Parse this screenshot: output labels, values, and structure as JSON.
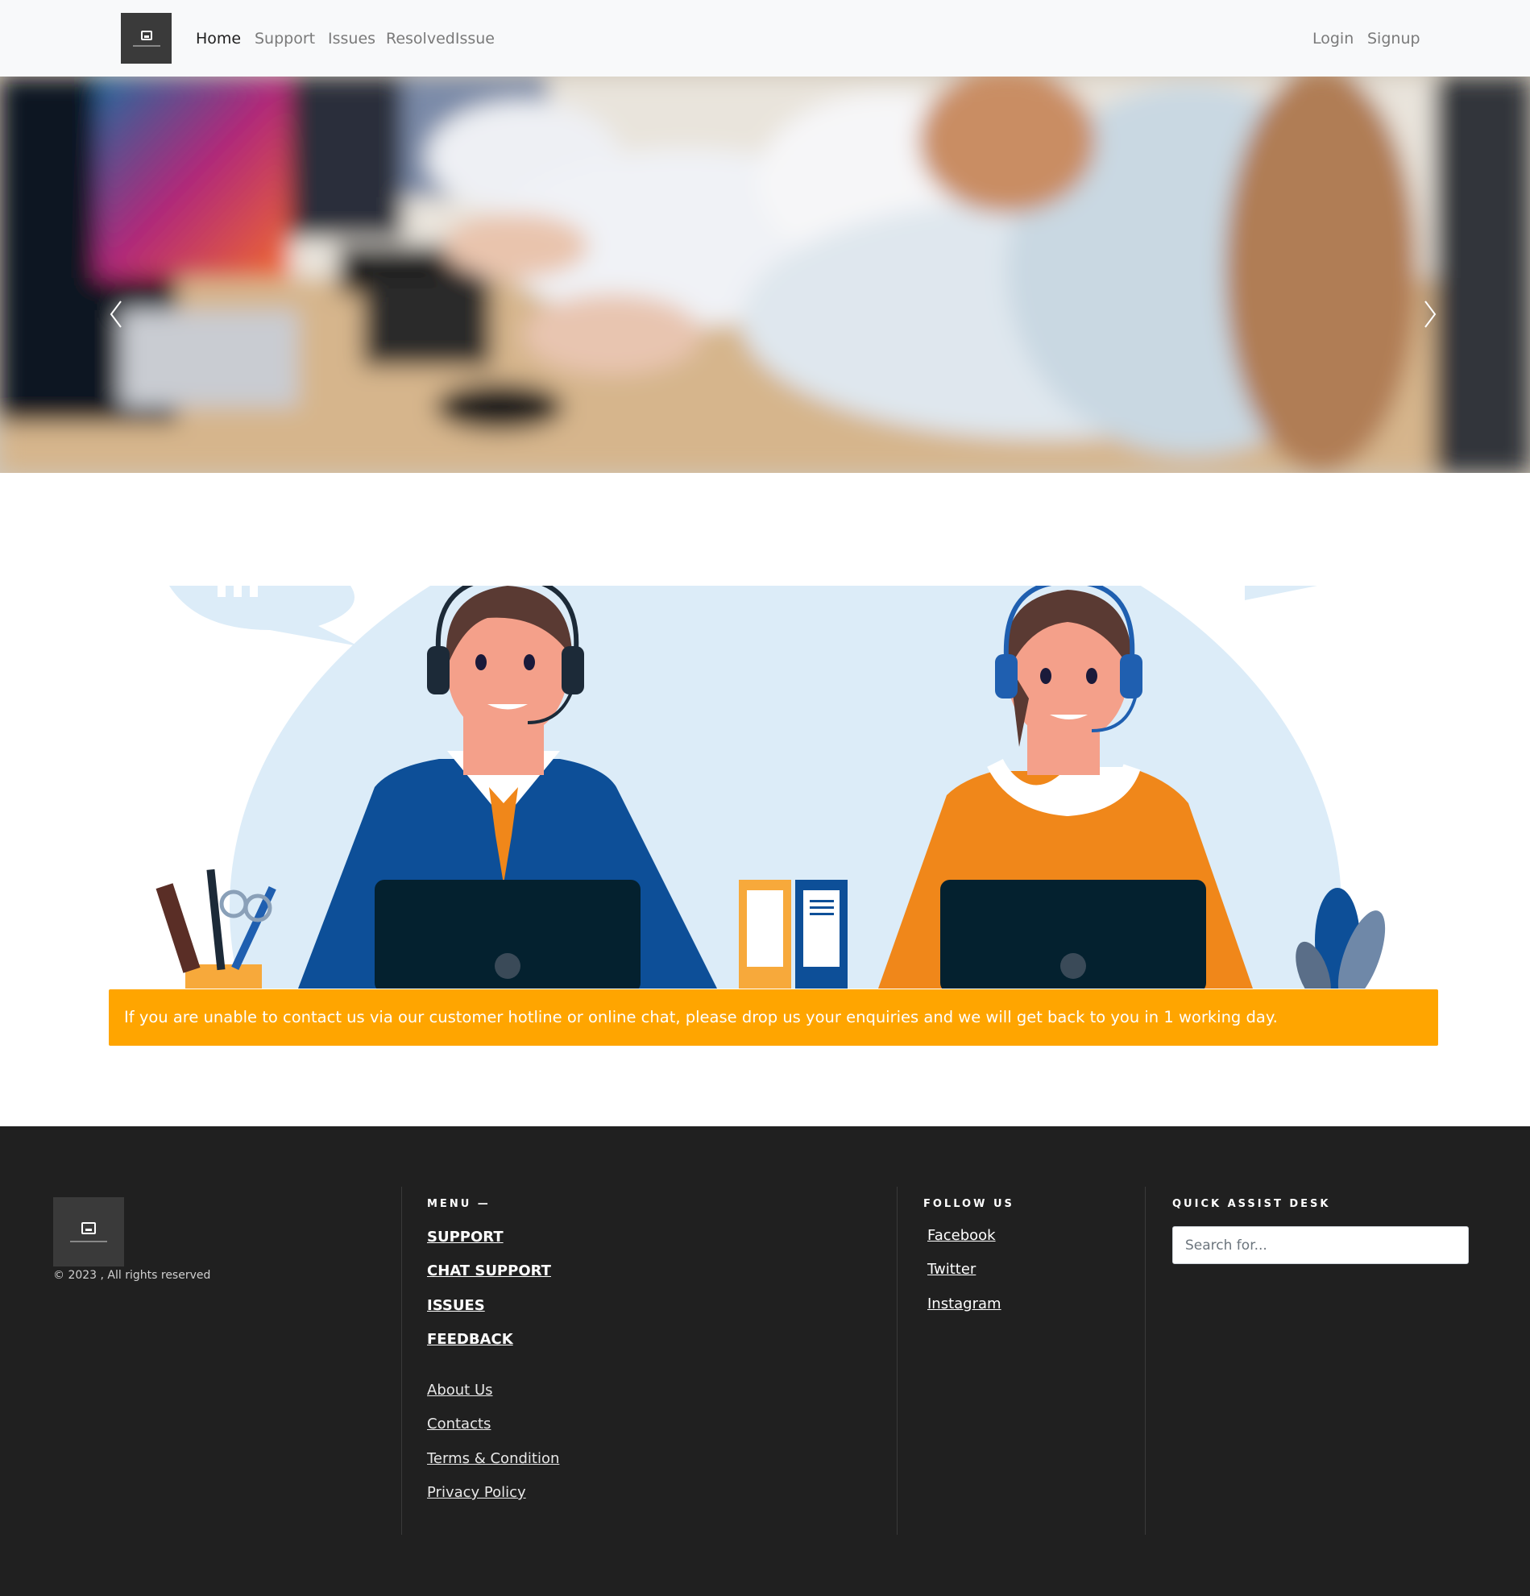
{
  "navbar": {
    "links": [
      {
        "label": "Home",
        "active": true
      },
      {
        "label": "Support"
      },
      {
        "label": "Issues"
      },
      {
        "label": "ResolvedIssue"
      }
    ],
    "auth": [
      {
        "label": "Login"
      },
      {
        "label": "Signup"
      }
    ]
  },
  "hero": {
    "prev_icon": "chevron-left-icon",
    "next_icon": "chevron-right-icon"
  },
  "notice": {
    "text": "If you are unable to contact us via our customer hotline or online chat, please drop us your enquiries and we will get back to you in 1 working day.",
    "color": "#ffa500"
  },
  "footer": {
    "copyright": "© 2023 , All rights reserved",
    "menu_title": "MENU —",
    "menu_primary": [
      "SUPPORT",
      "CHAT SUPPORT",
      "ISSUES",
      "FEEDBACK"
    ],
    "menu_secondary": [
      "About Us",
      "Contacts",
      "Terms & Condition",
      "Privacy Policy"
    ],
    "follow_title": "FOLLOW US",
    "follow_links": [
      "Facebook",
      "Twitter",
      "Instagram"
    ],
    "quick_title": "QUICK ASSIST DESK",
    "search_placeholder": "Search for...",
    "background": "#202020"
  }
}
